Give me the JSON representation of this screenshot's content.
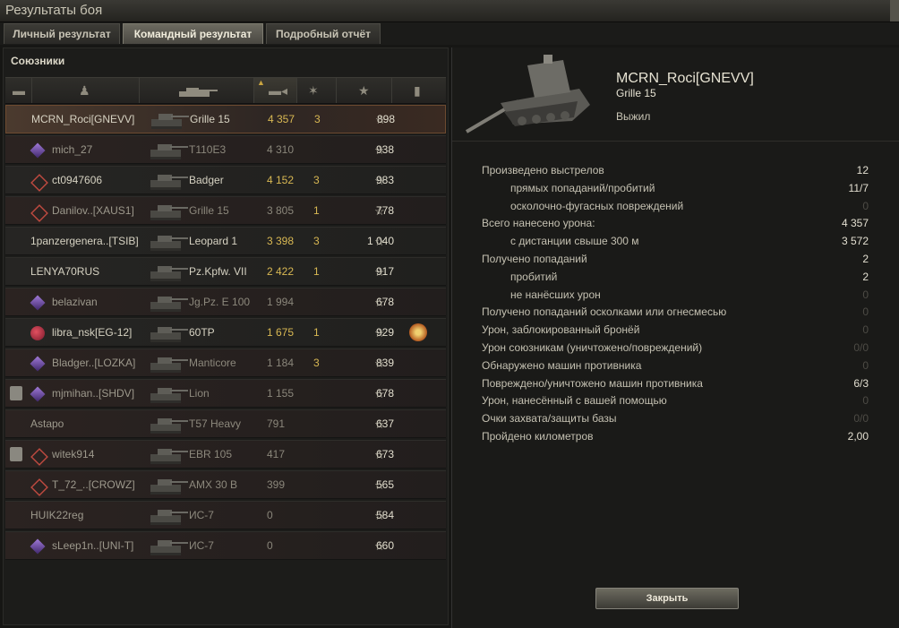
{
  "window": {
    "title": "Результаты боя"
  },
  "tabs": [
    {
      "label": "Личный результат"
    },
    {
      "label": "Командный результат",
      "active": true
    },
    {
      "label": "Подробный отчёт"
    }
  ],
  "team": {
    "title": "Союзники",
    "columns": [
      "platoon-icon",
      "player-icon",
      "tank-icon",
      "damage-icon",
      "kills-icon",
      "xp-star-icon",
      "medal-icon"
    ],
    "rows": [
      {
        "player": "MCRN_Roci[GNEVV]",
        "vehicle": "Grille 15",
        "damage": "4 357",
        "kills": "3",
        "xp": "898",
        "me": true,
        "dead": false,
        "badge": "",
        "platoon": false,
        "medal": false
      },
      {
        "player": "mich_27",
        "vehicle": "T110E3",
        "damage": "4 310",
        "kills": "",
        "xp": "938",
        "me": false,
        "dead": true,
        "badge": "purple",
        "platoon": false,
        "medal": false
      },
      {
        "player": "ct0947606",
        "vehicle": "Badger",
        "damage": "4 152",
        "kills": "3",
        "xp": "983",
        "me": false,
        "dead": false,
        "badge": "diamond",
        "platoon": false,
        "medal": false
      },
      {
        "player": "Danilov..[XAUS1]",
        "vehicle": "Grille 15",
        "damage": "3 805",
        "kills": "1",
        "xp": "778",
        "me": false,
        "dead": true,
        "badge": "diamond",
        "platoon": false,
        "medal": false
      },
      {
        "player": "1panzergenera..[TSIB]",
        "vehicle": "Leopard 1",
        "damage": "3 398",
        "kills": "3",
        "xp": "1 040",
        "me": false,
        "dead": false,
        "badge": "",
        "platoon": false,
        "medal": false
      },
      {
        "player": "LENYA70RUS",
        "vehicle": "Pz.Kpfw. VII",
        "damage": "2 422",
        "kills": "1",
        "xp": "917",
        "me": false,
        "dead": false,
        "badge": "",
        "platoon": false,
        "medal": false
      },
      {
        "player": "belazivan",
        "vehicle": "Jg.Pz. E 100",
        "damage": "1 994",
        "kills": "",
        "xp": "678",
        "me": false,
        "dead": true,
        "badge": "purple",
        "platoon": false,
        "medal": false
      },
      {
        "player": "libra_nsk[EG-12]",
        "vehicle": "60TP",
        "damage": "1 675",
        "kills": "1",
        "xp": "929",
        "me": false,
        "dead": false,
        "badge": "red",
        "platoon": false,
        "medal": true
      },
      {
        "player": "Bladger..[LOZKA]",
        "vehicle": "Manticore",
        "damage": "1 184",
        "kills": "3",
        "xp": "839",
        "me": false,
        "dead": true,
        "badge": "purple",
        "platoon": false,
        "medal": false
      },
      {
        "player": "mjmihan..[SHDV]",
        "vehicle": "Lion",
        "damage": "1 155",
        "kills": "",
        "xp": "678",
        "me": false,
        "dead": true,
        "badge": "purple",
        "platoon": true,
        "medal": false
      },
      {
        "player": "Astapo",
        "vehicle": "T57 Heavy",
        "damage": "791",
        "kills": "",
        "xp": "637",
        "me": false,
        "dead": true,
        "badge": "",
        "platoon": false,
        "medal": false
      },
      {
        "player": "witek914",
        "vehicle": "EBR 105",
        "damage": "417",
        "kills": "",
        "xp": "673",
        "me": false,
        "dead": true,
        "badge": "diamond",
        "platoon": true,
        "medal": false
      },
      {
        "player": "T_72_..[CROWZ]",
        "vehicle": "AMX 30 B",
        "damage": "399",
        "kills": "",
        "xp": "565",
        "me": false,
        "dead": true,
        "badge": "diamond",
        "platoon": false,
        "medal": false
      },
      {
        "player": "HUIK22reg",
        "vehicle": "ИС-7",
        "damage": "0",
        "kills": "",
        "xp": "584",
        "me": false,
        "dead": true,
        "badge": "",
        "platoon": false,
        "medal": false
      },
      {
        "player": "sLeep1n..[UNI-T]",
        "vehicle": "ИС-7",
        "damage": "0",
        "kills": "",
        "xp": "660",
        "me": false,
        "dead": true,
        "badge": "purple",
        "platoon": false,
        "medal": false
      }
    ]
  },
  "detail": {
    "player": "MCRN_Roci[GNEVV]",
    "vehicle": "Grille 15",
    "status": "Выжил",
    "stats": [
      {
        "label": "Произведено выстрелов",
        "value": "12",
        "sub": false,
        "zero": false
      },
      {
        "label": "прямых попаданий/пробитий",
        "value": "11/7",
        "sub": true,
        "zero": false
      },
      {
        "label": "осколочно-фугасных повреждений",
        "value": "0",
        "sub": true,
        "zero": true
      },
      {
        "label": "Всего нанесено урона:",
        "value": "4 357",
        "sub": false,
        "zero": false
      },
      {
        "label": "с дистанции свыше 300 м",
        "value": "3 572",
        "sub": true,
        "zero": false
      },
      {
        "label": "Получено попаданий",
        "value": "2",
        "sub": false,
        "zero": false
      },
      {
        "label": "пробитий",
        "value": "2",
        "sub": true,
        "zero": false
      },
      {
        "label": "не нанёсших урон",
        "value": "0",
        "sub": true,
        "zero": true
      },
      {
        "label": "Получено попаданий осколками или огнесмесью",
        "value": "0",
        "sub": false,
        "zero": true
      },
      {
        "label": "Урон, заблокированный бронёй",
        "value": "0",
        "sub": false,
        "zero": true
      },
      {
        "label": "Урон союзникам (уничтожено/повреждений)",
        "value": "0/0",
        "sub": false,
        "zero": true
      },
      {
        "label": "Обнаружено машин противника",
        "value": "0",
        "sub": false,
        "zero": true
      },
      {
        "label": "Повреждено/уничтожено машин противника",
        "value": "6/3",
        "sub": false,
        "zero": false
      },
      {
        "label": "Урон, нанесённый с вашей помощью",
        "value": "0",
        "sub": false,
        "zero": true
      },
      {
        "label": "Очки захвата/защиты базы",
        "value": "0/0",
        "sub": false,
        "zero": true
      },
      {
        "label": "Пройдено километров",
        "value": "2,00",
        "sub": false,
        "zero": false
      }
    ],
    "close_label": "Закрыть"
  }
}
